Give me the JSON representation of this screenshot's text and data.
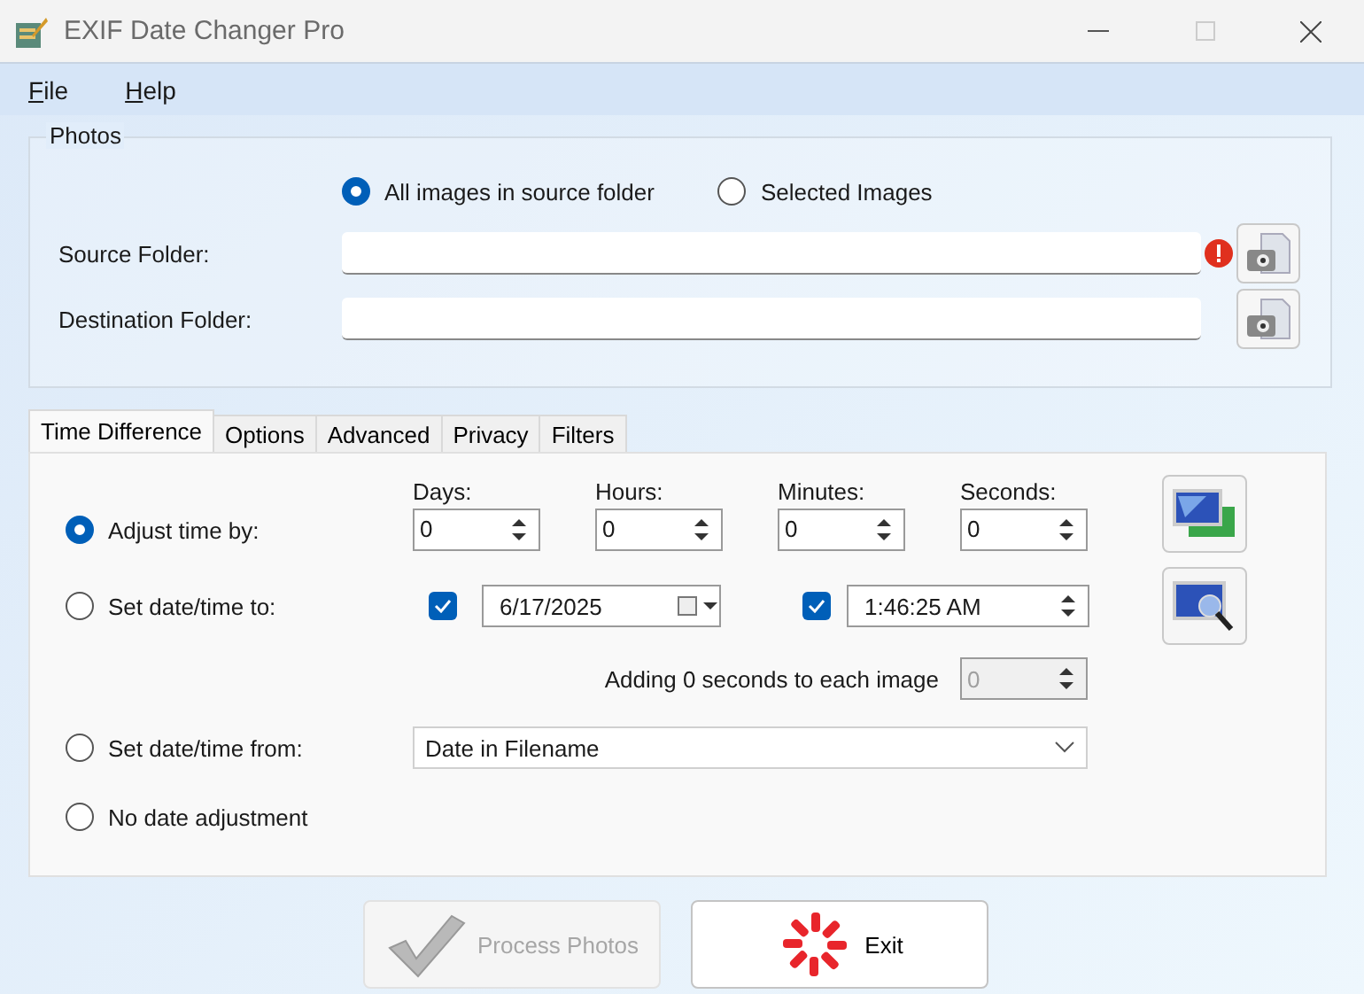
{
  "window": {
    "title": "EXIF Date Changer Pro"
  },
  "menu": [
    {
      "label": "File"
    },
    {
      "label": "Help"
    }
  ],
  "photos": {
    "title": "Photos",
    "scope": [
      {
        "label": "All images in source folder",
        "selected": true
      },
      {
        "label": "Selected Images",
        "selected": false
      }
    ],
    "folders": [
      {
        "label": "Source Folder:",
        "warning": true
      },
      {
        "label": "Destination Folder:",
        "warning": false
      }
    ]
  },
  "tabs": [
    {
      "label": "Time Difference",
      "selected": true
    },
    {
      "label": "Options",
      "selected": false
    },
    {
      "label": "Advanced",
      "selected": false
    },
    {
      "label": "Privacy",
      "selected": false
    },
    {
      "label": "Filters",
      "selected": false
    }
  ],
  "modes": [
    {
      "label": "Adjust time by:",
      "selected": true
    },
    {
      "label": "Set date/time to:",
      "selected": false
    },
    {
      "label": "Set date/time from:",
      "selected": false
    },
    {
      "label": "No date adjustment",
      "selected": false
    }
  ],
  "adjust_fields": [
    {
      "label": "Days:",
      "value": "0"
    },
    {
      "label": "Hours:",
      "value": "0"
    },
    {
      "label": "Minutes:",
      "value": "0"
    },
    {
      "label": "Seconds:",
      "value": "0"
    }
  ],
  "set_to": {
    "date_checked": true,
    "date": "6/17/2025",
    "time_checked": true,
    "time": "1:46:25 AM"
  },
  "adding": {
    "text": "Adding 0 seconds to each image",
    "value": "0",
    "disabled": true
  },
  "from_source": {
    "value": "Date in Filename"
  },
  "buttons": [
    {
      "kind": "process",
      "label": "Process Photos",
      "disabled": true
    },
    {
      "kind": "exit",
      "label": "Exit",
      "disabled": false
    }
  ]
}
